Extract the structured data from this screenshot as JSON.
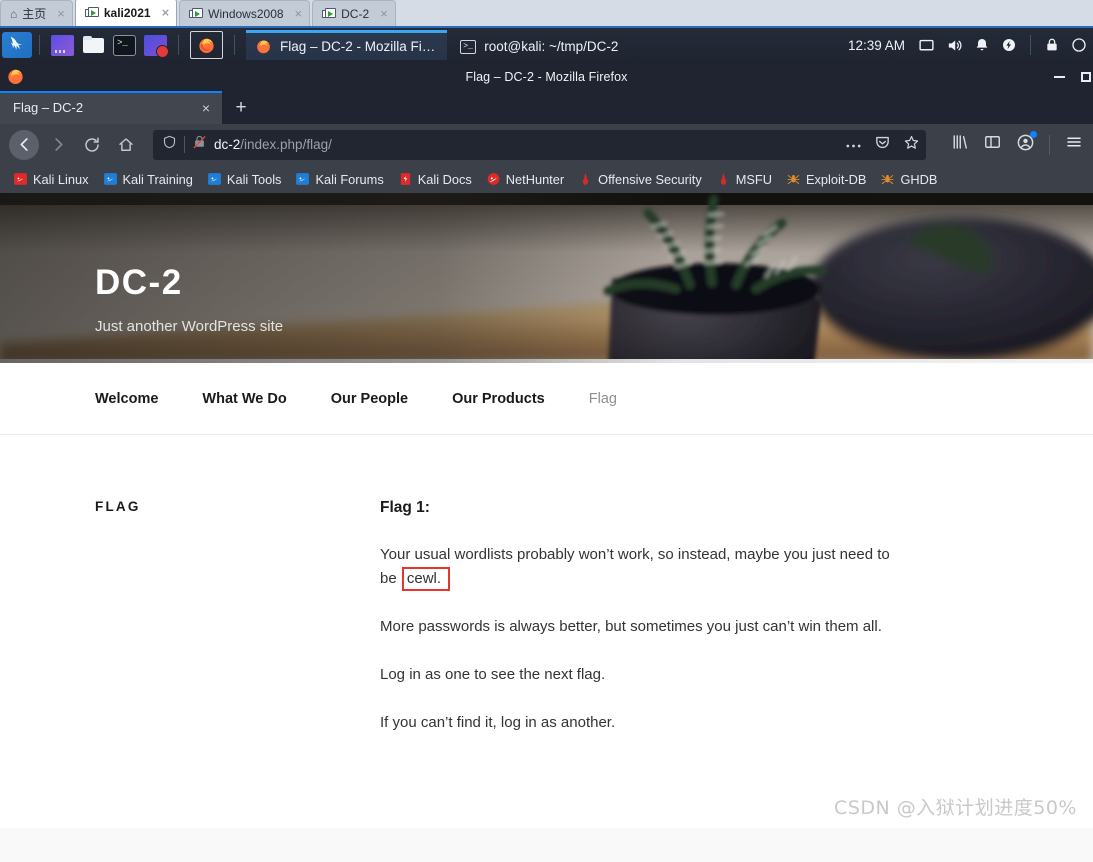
{
  "vmware": {
    "tabs": [
      {
        "label": "主页",
        "icon": "home-icon",
        "active": false,
        "close": "×"
      },
      {
        "label": "kali2021",
        "icon": "vm-screen-icon",
        "active": true,
        "close": "×"
      },
      {
        "label": "Windows2008",
        "icon": "vm-screen-icon",
        "active": false,
        "close": "×"
      },
      {
        "label": "DC-2",
        "icon": "vm-screen-icon",
        "active": false,
        "close": "×"
      }
    ]
  },
  "taskbar": {
    "launchers": [
      {
        "name": "kali-menu-icon",
        "title": "Kali"
      },
      {
        "name": "workspace-switcher-icon",
        "title": "Workspaces"
      },
      {
        "name": "file-manager-icon",
        "title": "Files"
      },
      {
        "name": "terminal-icon",
        "title": "Terminal"
      },
      {
        "name": "screen-recorder-icon",
        "title": "Recorder"
      },
      {
        "name": "firefox-launcher-icon",
        "title": "Firefox"
      }
    ],
    "windows": [
      {
        "label": "Flag – DC-2 - Mozilla Fi…",
        "icon": "firefox-icon",
        "active": true
      },
      {
        "label": "root@kali: ~/tmp/DC-2",
        "icon": "terminal-icon",
        "active": false
      }
    ],
    "clock": "12:39 AM",
    "tray_icons": [
      "display-icon",
      "volume-icon",
      "notification-bell-icon",
      "power-icon",
      "lock-icon",
      "user-icon"
    ]
  },
  "firefox": {
    "window_title": "Flag – DC-2 - Mozilla Firefox",
    "window_controls": {
      "minimize": "minimize-icon",
      "maximize": "maximize-icon"
    },
    "tabs": [
      {
        "label": "Flag – DC-2",
        "close": "×",
        "active": true
      }
    ],
    "new_tab_label": "+",
    "nav": {
      "back": "back-icon",
      "forward": "forward-icon",
      "reload": "reload-icon",
      "home": "home-icon"
    },
    "urlbar": {
      "host": "dc-2",
      "path": "/index.php/flag/",
      "shield_icon": "tracking-protection-shield-icon",
      "lock_icon": "insecure-connection-icon",
      "page_actions_icon": "page-actions-ellipsis-icon",
      "pocket_icon": "pocket-icon",
      "bookmark_icon": "bookmark-star-icon"
    },
    "toolbar_right": {
      "library_icon": "library-icon",
      "sidebar_icon": "sidebar-icon",
      "account_icon": "account-avatar-icon",
      "menu_icon": "hamburger-menu-icon"
    },
    "bookmarks": [
      {
        "label": "Kali Linux",
        "icon": "kali-red-icon"
      },
      {
        "label": "Kali Training",
        "icon": "kali-blue-icon"
      },
      {
        "label": "Kali Tools",
        "icon": "kali-blue-icon"
      },
      {
        "label": "Kali Forums",
        "icon": "kali-blue-icon"
      },
      {
        "label": "Kali Docs",
        "icon": "kali-docs-icon"
      },
      {
        "label": "NetHunter",
        "icon": "nethunter-icon"
      },
      {
        "label": "Offensive Security",
        "icon": "offensive-security-icon"
      },
      {
        "label": "MSFU",
        "icon": "offensive-security-icon"
      },
      {
        "label": "Exploit-DB",
        "icon": "exploit-db-spider-icon"
      },
      {
        "label": "GHDB",
        "icon": "exploit-db-spider-icon"
      }
    ]
  },
  "site": {
    "hero": {
      "title": "DC-2",
      "tagline": "Just another WordPress site"
    },
    "menu": [
      {
        "label": "Welcome",
        "current": false
      },
      {
        "label": "What We Do",
        "current": false
      },
      {
        "label": "Our People",
        "current": false
      },
      {
        "label": "Our Products",
        "current": false
      },
      {
        "label": "Flag",
        "current": true
      }
    ],
    "sidebar_heading": "FLAG",
    "article": {
      "heading": "Flag 1:",
      "p1_before": "Your usual wordlists probably won’t work, so instead, maybe you just need to be",
      "p1_highlight": "cewl.",
      "p2": "More passwords is always better, but sometimes you just can’t win them all.",
      "p3": "Log in as one to see the next flag.",
      "p4": "If you can’t find it, log in as another."
    },
    "highlight_color": "#e8352b"
  },
  "watermark": "CSDN @入狱计划进度50%"
}
